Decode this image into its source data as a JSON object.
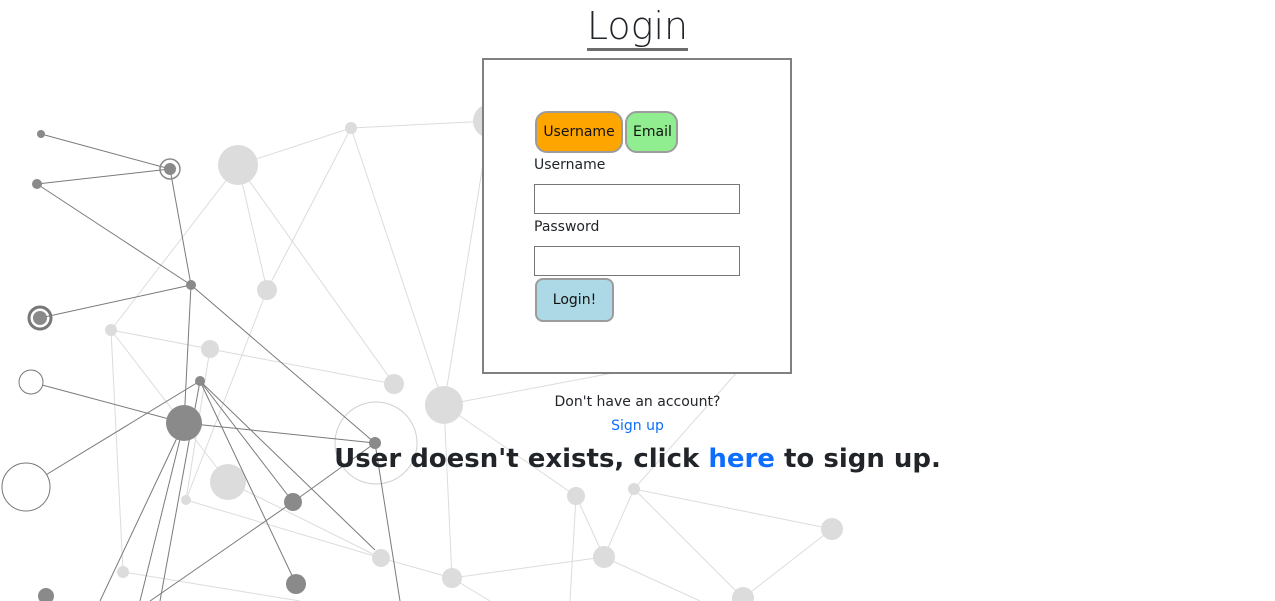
{
  "page": {
    "title": "Login"
  },
  "login_form": {
    "toggle": {
      "username_label": "Username",
      "email_label": "Email"
    },
    "username_label": "Username",
    "username_value": "",
    "password_label": "Password",
    "password_value": "",
    "submit_label": "Login!"
  },
  "footer": {
    "no_account_text": "Don't have an account?",
    "signup_link_label": "Sign up"
  },
  "error": {
    "prefix": "User doesn't exists, click ",
    "link_label": "here",
    "suffix": " to sign up."
  },
  "colors": {
    "username_toggle": "#ffa500",
    "email_toggle": "#90ee90",
    "submit_button": "#add8e6",
    "link": "#0d6efd"
  }
}
